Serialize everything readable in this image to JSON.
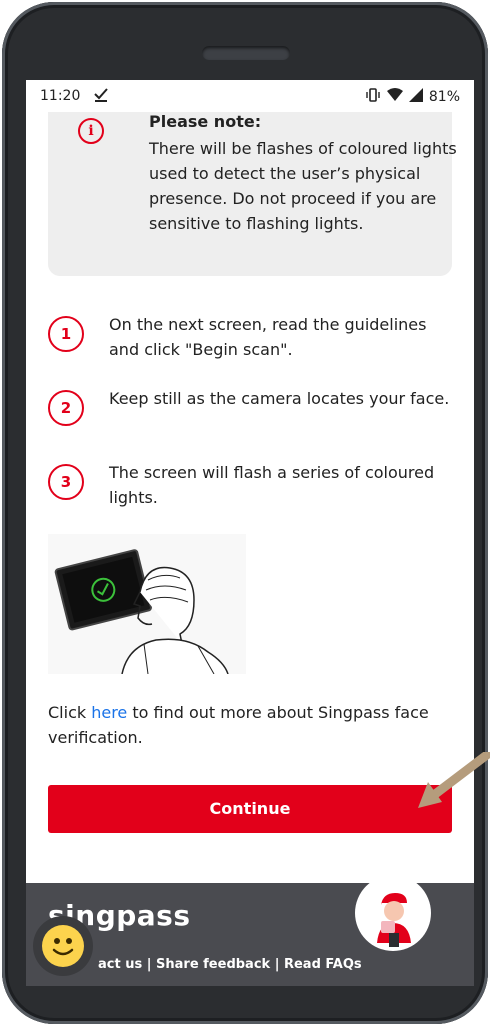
{
  "status_bar": {
    "time": "11:20",
    "battery": "81%"
  },
  "notice": {
    "icon": "info-icon",
    "title": "Please note:",
    "body": "There will be flashes of coloured lights used to detect the user’s physical presence. Do not proceed if you are sensitive to flashing lights."
  },
  "steps": [
    {
      "number": "1",
      "text": "On the next screen, read the guidelines and click \"Begin scan\"."
    },
    {
      "number": "2",
      "text": "Keep still as the camera locates your face."
    },
    {
      "number": "3",
      "text": "The screen will flash a series of coloured lights."
    }
  ],
  "info": {
    "prefix": "Click ",
    "link": "here",
    "suffix": " to find out more about Singpass face verification."
  },
  "continue_button": "Continue",
  "footer": {
    "logo": "singpass",
    "links": "act us | Share feedback | Read FAQs"
  },
  "colors": {
    "accent": "#e2001a",
    "link": "#1a73e8",
    "footer_bg": "#4a4b50",
    "notice_bg": "#eeeeee"
  }
}
